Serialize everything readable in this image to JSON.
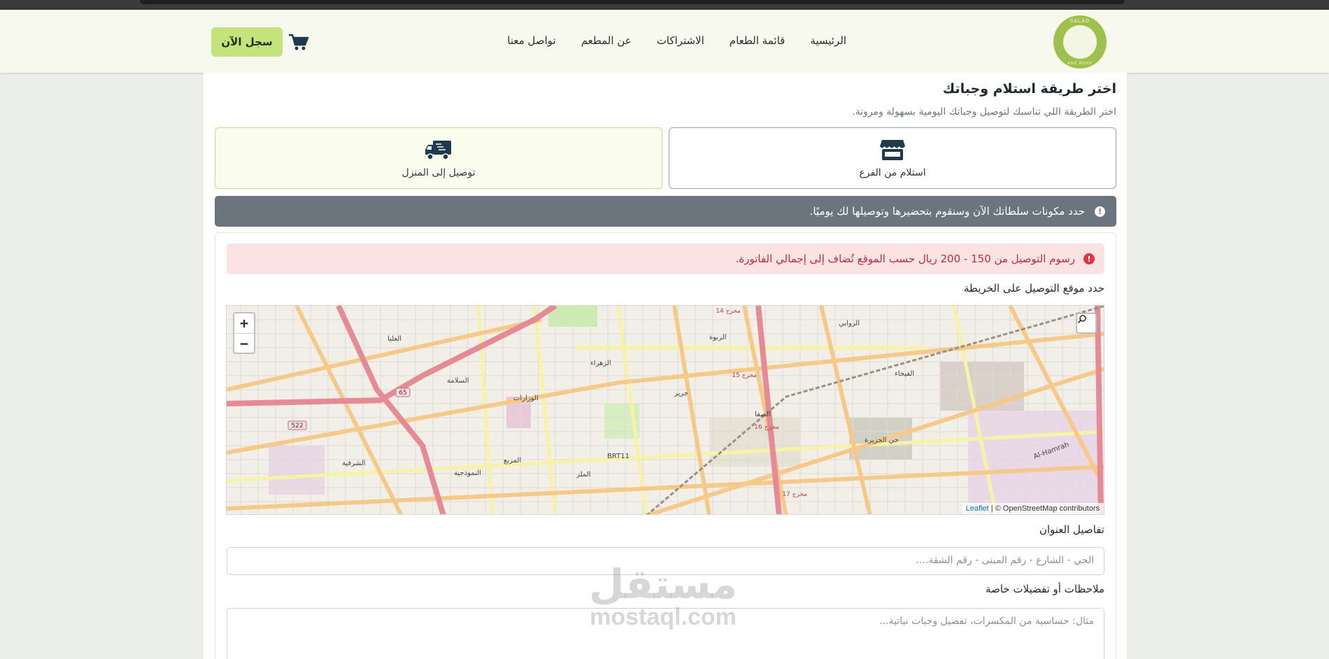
{
  "navbar": {
    "logo_text_top": "SALAD",
    "logo_text_bottom": "AND MORE",
    "links": [
      "الرئيسية",
      "قائمة الطعام",
      "الاشتراكات",
      "عن المطعم",
      "تواصل معنا"
    ],
    "cart_icon": "cart-icon",
    "signup_label": "سجل الآن"
  },
  "main": {
    "title": "اختر طريقة استلام وجباتك",
    "subtitle": "اختر الطريقة اللي تناسبك لتوصيل وجباتك اليومية بسهولة ومرونة.",
    "options": {
      "pickup": {
        "label": "استلام من الفرع",
        "icon": "store-icon"
      },
      "delivery": {
        "label": "توصيل إلى المنزل",
        "icon": "truck-icon"
      }
    },
    "info": "حدد مكونات سلطاتك الآن وسنقوم بتحضيرها وتوصيلها لك يوميًا."
  },
  "form": {
    "delivery_fee_alert": "رسوم التوصيل من 150 - 200 ريال حسب الموقع تُضاف إلى إجمالي الفاتورة.",
    "map_label": "حدد موقع التوصيل على الخريطة",
    "map": {
      "zoom_in": "+",
      "zoom_out": "−",
      "search_icon": "search-icon",
      "attribution_link": "Leaflet",
      "attribution_text": "| © OpenStreetMap contributors",
      "labels": {
        "olaya": "العليا",
        "salama": "السلامة",
        "wizarat": "الوزارات",
        "zahra": "الزهراء",
        "rabwa": "الربوة",
        "jarir": "جرير",
        "safa": "الصفا",
        "rawabi": "الروابي",
        "faiha": "الفيحاء",
        "jazira": "حي الجزيرة",
        "sharafiya": "الشرفية",
        "murabba": "المربع",
        "namudhajiya": "النموذجية",
        "malaz": "الملز",
        "hamrah": "Al-Hamrah",
        "brt": "BRT11",
        "route65": "65",
        "route522": "522",
        "exit14": "مخرج 14",
        "exit15": "مخرج 15",
        "exit16": "مخرج 16",
        "exit17": "مخرج 17"
      }
    },
    "address_label": "تفاصيل العنوان",
    "address_placeholder": "الحي - الشارع - رقم المبنى - رقم الشقة....",
    "notes_label": "ملاحظات أو تفضيلات خاصة",
    "notes_placeholder": "مثال: حساسية من المكسرات، تفضيل وجبات نباتية..."
  },
  "watermark": {
    "arabic": "مستقل",
    "latin": "mostaql.com"
  },
  "colors": {
    "accent": "#c5e37b",
    "info_bar": "#6c757d",
    "alert_bg": "#fbe3e4",
    "alert_text": "#c02a3a"
  }
}
